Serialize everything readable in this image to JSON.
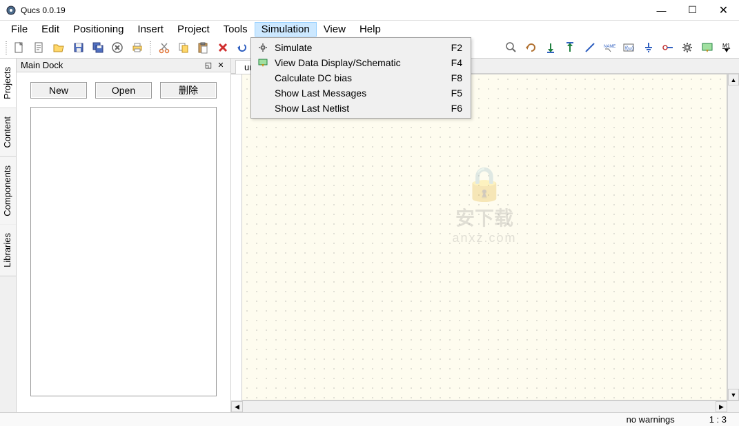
{
  "window": {
    "title": "Qucs 0.0.19"
  },
  "menubar": [
    "File",
    "Edit",
    "Positioning",
    "Insert",
    "Project",
    "Tools",
    "Simulation",
    "View",
    "Help"
  ],
  "active_menu": "Simulation",
  "dropdown": {
    "items": [
      {
        "label": "Simulate",
        "shortcut": "F2",
        "icon": "gear"
      },
      {
        "label": "View Data Display/Schematic",
        "shortcut": "F4",
        "icon": "display"
      },
      {
        "label": "Calculate DC bias",
        "shortcut": "F8",
        "icon": ""
      },
      {
        "label": "Show Last Messages",
        "shortcut": "F5",
        "icon": ""
      },
      {
        "label": "Show Last Netlist",
        "shortcut": "F6",
        "icon": ""
      }
    ]
  },
  "dock": {
    "title": "Main Dock",
    "tabs": [
      "Projects",
      "Content",
      "Components",
      "Libraries"
    ],
    "active_tab": "Projects",
    "buttons": {
      "new": "New",
      "open": "Open",
      "delete": "删除"
    }
  },
  "file_tab": "unti",
  "statusbar": {
    "warnings": "no warnings",
    "position": "1 : 3"
  },
  "watermark": {
    "line1": "安下载",
    "line2": "anxz.com"
  },
  "toolbar_icons": [
    "new-file",
    "new-text",
    "open",
    "save",
    "save-all",
    "close",
    "print",
    "cut",
    "copy",
    "paste",
    "delete",
    "undo",
    "redo",
    "zoom-in",
    "zoom-out",
    "back",
    "forward",
    "down",
    "up",
    "wire",
    "name",
    "function",
    "ground",
    "port",
    "gear",
    "sim-display",
    "m1"
  ],
  "colors": {
    "canvas": "#fefcef",
    "menu_hl": "#cce8ff"
  }
}
